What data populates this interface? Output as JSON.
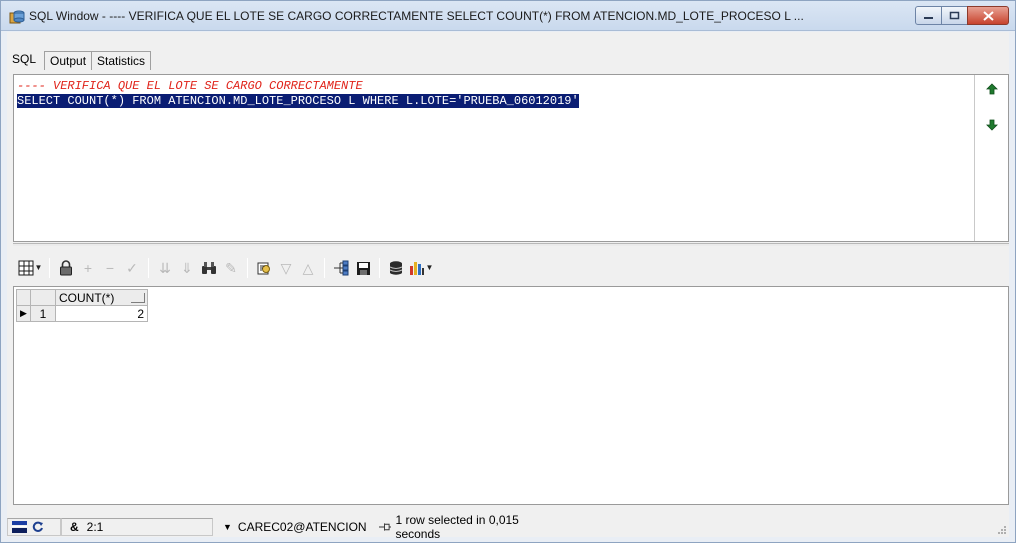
{
  "window": {
    "title": "SQL Window - ---- VERIFICA QUE EL LOTE SE CARGO CORRECTAMENTE SELECT COUNT(*) FROM ATENCION.MD_LOTE_PROCESO L ..."
  },
  "tabs": [
    {
      "label": "SQL"
    },
    {
      "label": "Output"
    },
    {
      "label": "Statistics"
    }
  ],
  "editor": {
    "lines": [
      "---- VERIFICA QUE EL LOTE SE CARGO CORRECTAMENTE",
      "SELECT COUNT(*) FROM ATENCION.MD_LOTE_PROCESO L WHERE L.LOTE='PRUEBA_06012019'"
    ]
  },
  "grid": {
    "columns": [
      "COUNT(*)"
    ],
    "rows": [
      {
        "num": "1",
        "values": [
          "2"
        ]
      }
    ]
  },
  "status": {
    "keyboard_mode": "&",
    "cursor_position": "2:1",
    "connection": "CAREC02@ATENCION",
    "message": "1 row selected in 0,015 seconds"
  },
  "colors": {
    "selection": "#0a1d73",
    "comment": "#e0241b"
  }
}
